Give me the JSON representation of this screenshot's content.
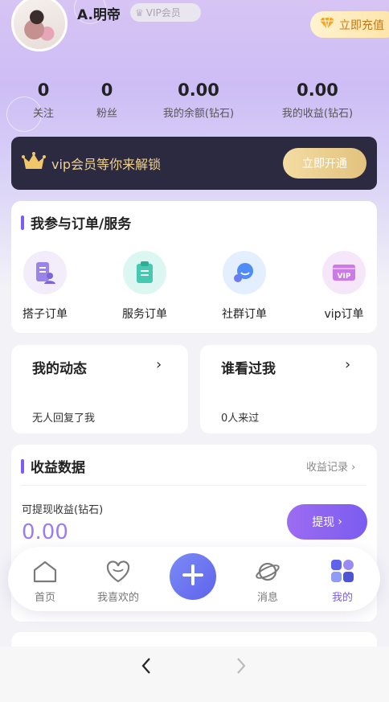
{
  "profile": {
    "username": "A.明帝",
    "vip_badge": "VIP会员",
    "recharge_label": "立即充值"
  },
  "stats": [
    {
      "value": "0",
      "label": "关注"
    },
    {
      "value": "0",
      "label": "粉丝"
    },
    {
      "value": "0.00",
      "label": "我的余额(钻石)"
    },
    {
      "value": "0.00",
      "label": "我的收益(钻石)"
    }
  ],
  "vip_banner": {
    "text": "vip会员等你来解锁",
    "button": "立即开通"
  },
  "orders": {
    "title": "我参与订单/服务",
    "items": [
      {
        "label": "搭子订单",
        "icon": "partner-order-icon"
      },
      {
        "label": "服务订单",
        "icon": "service-order-icon"
      },
      {
        "label": "社群订单",
        "icon": "community-order-icon"
      },
      {
        "label": "vip订单",
        "icon": "vip-order-icon"
      }
    ]
  },
  "activity": {
    "title": "我的动态",
    "subtitle": "无人回复了我"
  },
  "visitors": {
    "title": "谁看过我",
    "subtitle": "0人来过"
  },
  "earnings": {
    "title": "收益数据",
    "record_link": "收益记录",
    "withdrawable_label": "可提现收益(钻石)",
    "withdrawable_value": "0.00",
    "withdraw_button": "提现"
  },
  "tabbar": {
    "items": [
      {
        "label": "首页",
        "icon": "home-icon"
      },
      {
        "label": "我喜欢的",
        "icon": "heart-icon"
      },
      {
        "label": "消息",
        "icon": "planet-icon"
      },
      {
        "label": "我的",
        "icon": "profile-blocks-icon"
      }
    ],
    "active": "我的"
  },
  "colors": {
    "accent": "#7b5cf0",
    "vip_gold": "#f1d28d",
    "vip_bar_bg": "#2b2a40"
  }
}
